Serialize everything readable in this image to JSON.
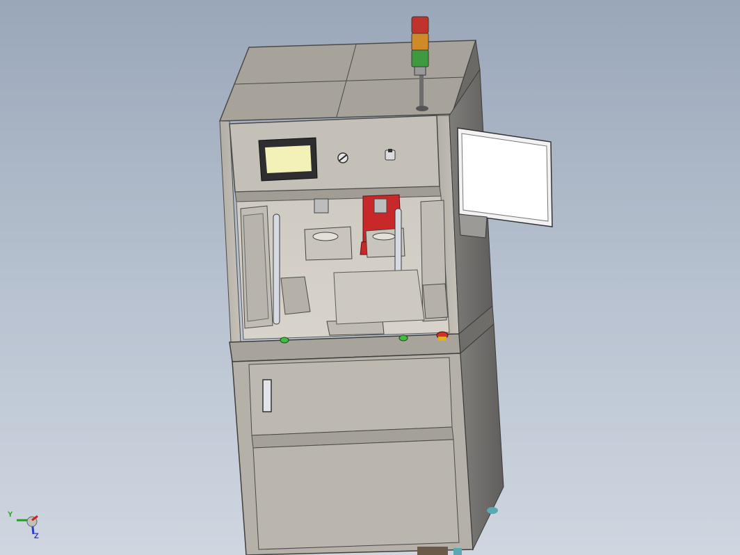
{
  "viewport": {
    "model_name": "",
    "colors": {
      "background_top": "#9aa7b9",
      "background_bottom": "#cfd6e0",
      "frame": "#bcb8b0",
      "frame_dark": "#8c8a86",
      "hmi_screen": "#f3f0b8",
      "tower_red": "#c0322c",
      "tower_amber": "#d08a2a",
      "tower_green": "#3e9a3e",
      "red_parts": "#c8282a"
    }
  },
  "triad": {
    "x_axis": "X",
    "y_axis": "Y",
    "z_axis": "Z"
  },
  "components": [
    "signal-tower",
    "top-cover",
    "control-panel",
    "hmi-screen",
    "selector-switch",
    "key-switch",
    "monitor-swing-arm",
    "work-area",
    "start-buttons",
    "emergency-stop",
    "cabinet-door",
    "door-handle",
    "lower-panel"
  ]
}
